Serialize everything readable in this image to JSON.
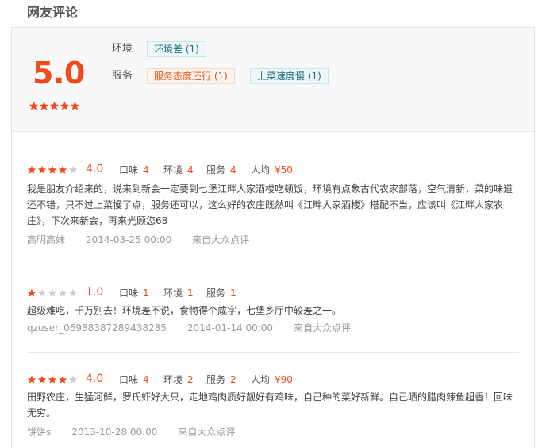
{
  "section_title": "网友评论",
  "summary": {
    "score": "5.0",
    "star_rating": 5,
    "categories": [
      {
        "label": "环境",
        "tags": [
          {
            "text": "环境差 (1)",
            "tone": "neutral"
          }
        ]
      },
      {
        "label": "服务",
        "tags": [
          {
            "text": "服务态度还行 (1)",
            "tone": "warn"
          },
          {
            "text": "上菜速度慢 (1)",
            "tone": "neutral"
          }
        ]
      }
    ]
  },
  "reviews": [
    {
      "star_rating": 4,
      "score": "4.0",
      "metrics": [
        {
          "label": "口味",
          "value": "4"
        },
        {
          "label": "环境",
          "value": "4"
        },
        {
          "label": "服务",
          "value": "4"
        },
        {
          "label": "人均",
          "value": "¥50"
        }
      ],
      "text_lines": [
        "我是朋友介绍来的，说来到新会一定要到七堡江畔人家酒楼吃顿饭，环境有点象古代农家部落，空气清新，菜的味道",
        "还不错，只不过上菜慢了点，服务还可以，这么好的农庄既然叫《江畔人家酒楼》搭配不当，应该叫《江畔人家农",
        "庄》，下次来新会，再来光顾您68"
      ],
      "user": "高明高妹",
      "date": "2014-03-25 00:00",
      "source": "来自大众点评"
    },
    {
      "star_rating": 1,
      "score": "1.0",
      "metrics": [
        {
          "label": "口味",
          "value": "1"
        },
        {
          "label": "环境",
          "value": "1"
        },
        {
          "label": "服务",
          "value": "1"
        }
      ],
      "text_lines": [
        "超级难吃，千万别去！环境差不说，食物得个咸字，七堡乡厅中较差之一。"
      ],
      "user": "qzuser_06988387289438285",
      "date": "2014-01-14 00:00",
      "source": "来自大众点评"
    },
    {
      "star_rating": 4,
      "score": "4.0",
      "metrics": [
        {
          "label": "口味",
          "value": "4"
        },
        {
          "label": "环境",
          "value": "2"
        },
        {
          "label": "服务",
          "value": "2"
        },
        {
          "label": "人均",
          "value": "¥90"
        }
      ],
      "text_lines": [
        "田野农庄，生猛河鲜，罗氏虾好大只，走地鸡肉质好靓好有鸡味，自己种的菜好新鲜。自己晒的腊肉辣鱼超香！回味",
        "无穷。"
      ],
      "user": "饼饼s",
      "date": "2013-10-28 00:00",
      "source": "来自大众点评"
    }
  ],
  "colors": {
    "accent": "#f04a1a",
    "star_on": "#f04a1a",
    "star_off": "#cccccc"
  }
}
